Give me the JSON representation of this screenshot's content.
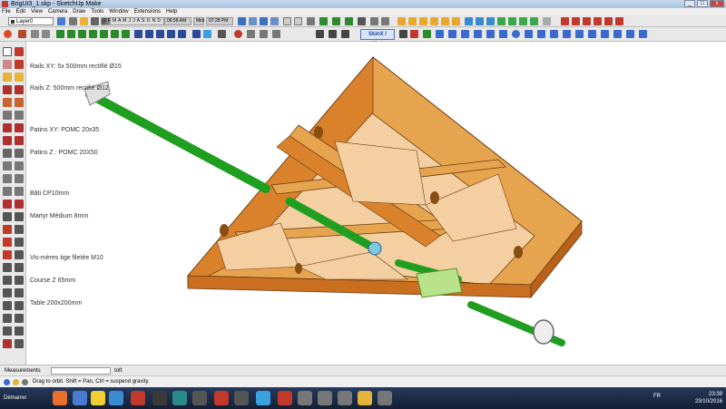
{
  "window": {
    "title": "BrigUt3_1.skp - SketchUp Make",
    "min": "_",
    "max": "□",
    "close": "x"
  },
  "menu": [
    "File",
    "Edit",
    "View",
    "Camera",
    "Draw",
    "Tools",
    "Window",
    "Extensions",
    "Help"
  ],
  "toolbar": {
    "layer": "Layer0",
    "shadow_months": "J F M A M J J A S O N D",
    "time1": "06:58 AM",
    "time_mid": "Midi",
    "time2": "07:28 PM",
    "skin_button": "SkinX / YBub"
  },
  "model_info": [
    "Rails XY: 5x 500mm rectifié Ø15",
    "Rails Z: 500mm rectifié Ø12",
    "",
    "Patins XY: POMC 20x35",
    "Patins Z : POMC 20X50",
    "",
    "Bâti CP10mm",
    "Martyr Médium 8mm",
    "",
    "Vis-mères tige filetée M10",
    "Course Z 65mm",
    "Table 200x200mm"
  ],
  "measurements": {
    "label": "Measurements",
    "value": "",
    "unit": "toft"
  },
  "status": {
    "message": "Drag to orbit. Shift = Pan, Ctrl = suspend gravity."
  },
  "taskbar": {
    "start": "Démarrer",
    "lang": "FR",
    "time": "23:39",
    "date": "23/10/2016"
  },
  "colors": {
    "wood_top": "#e7a44f",
    "wood_side": "#d9822b",
    "wood_inner": "#f3cfa2",
    "rod": "#1f9e1f",
    "accent": "#5c8a2e"
  }
}
